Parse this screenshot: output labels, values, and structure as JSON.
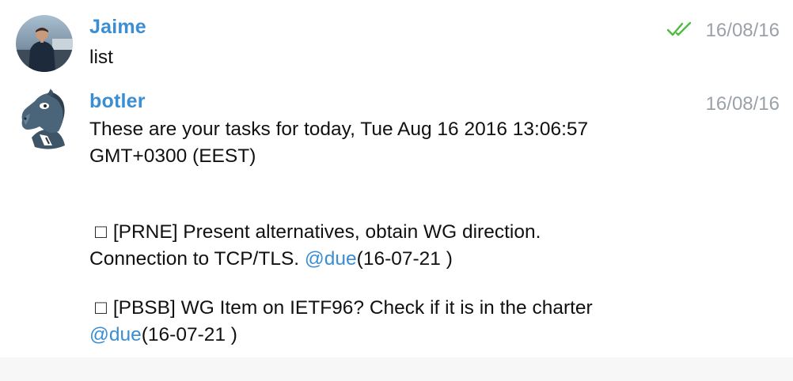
{
  "messages": [
    {
      "sender": "Jaime",
      "time": "16/08/16",
      "text": "list",
      "status_icon": "double-check-icon",
      "status_color": "#4dbb3e"
    },
    {
      "sender": "botler",
      "time": "16/08/16",
      "lines": [
        "These are your tasks for today, Tue Aug 16 2016 13:06:57",
        "GMT+0300 (EEST)"
      ],
      "tasks": [
        {
          "checkbox": "□",
          "line1": "[PRNE] Present alternatives, obtain WG direction.",
          "line2_text": "Connection to TCP/TLS. ",
          "mention": "@due",
          "due": "(16-07-21 )"
        },
        {
          "checkbox": "□",
          "line1": "[PBSB] WG Item on IETF96? Check if it is in the charter",
          "mention": "@due",
          "due": "(16-07-21 )"
        }
      ]
    }
  ],
  "colors": {
    "sender_name": "#3a8ed3",
    "mention": "#3a8ed3",
    "timestamp": "#9aa1a8",
    "read_check": "#4dbb3e"
  }
}
